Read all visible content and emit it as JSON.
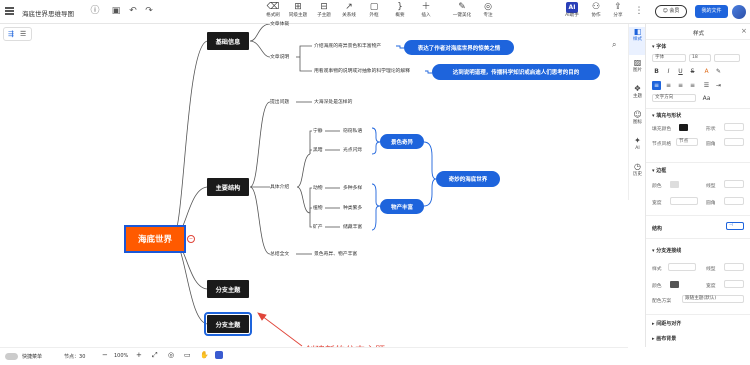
{
  "header": {
    "doc_title": "海底世界思维导图",
    "tools": [
      {
        "icon": "format-painter-icon",
        "label": "格式刷"
      },
      {
        "icon": "sibling-topic-icon",
        "label": "同级主题"
      },
      {
        "icon": "child-topic-icon",
        "label": "子主题"
      },
      {
        "icon": "relation-icon",
        "label": "关系线"
      },
      {
        "icon": "outline-box-icon",
        "label": "外框"
      },
      {
        "icon": "summary-icon",
        "label": "概要"
      },
      {
        "icon": "insert-icon",
        "label": "插入"
      },
      {
        "icon": "one-click-beautify-icon",
        "label": "一键美化"
      },
      {
        "icon": "focus-icon",
        "label": "专注"
      },
      {
        "icon": "ai-assistant-icon",
        "label": "AI助手",
        "badge": "AI"
      },
      {
        "icon": "collaborate-icon",
        "label": "协作"
      },
      {
        "icon": "share-icon",
        "label": "分享"
      }
    ],
    "upgrade_label": "会员",
    "my_files_label": "我的文件"
  },
  "mindmap": {
    "root": "海底世界",
    "branches": [
      {
        "label": "基础信息",
        "items": [
          {
            "label": "文章体裁"
          },
          {
            "label": "文章说明",
            "notes": [
              "介绍海底的奇异景色和丰富物产",
              "用看观事物的说明或对抽象的科学理论的解释"
            ],
            "callouts": [
              "表达了作者对海底世界的惊美之情",
              "达到说明道理，传播科学知识或启迪人们思考的目的"
            ]
          }
        ]
      },
      {
        "label": "主要结构",
        "items": [
          {
            "label": "提出问题",
            "answer": "大海深处是怎样的"
          },
          {
            "label": "具体介绍",
            "groups": [
              {
                "summary": "景色奇异",
                "rows": [
                  [
                    "宁静",
                    "窃窃私语"
                  ],
                  [
                    "黑暗",
                    "光点闪烁"
                  ]
                ]
              },
              {
                "summary": "物产丰富",
                "rows": [
                  [
                    "动物",
                    "多种多样"
                  ],
                  [
                    "植物",
                    "种类繁多"
                  ],
                  [
                    "矿产",
                    "储藏丰富"
                  ]
                ]
              }
            ],
            "conclusion": "奇妙的海底世界"
          },
          {
            "label": "总结全文",
            "answer": "景色奇异、物产丰富"
          }
        ]
      },
      {
        "label": "分支主题"
      },
      {
        "label": "分支主题"
      }
    ],
    "annotation": "创建新的分支主题"
  },
  "side_tabs": [
    {
      "icon": "style-icon",
      "label": "样式"
    },
    {
      "icon": "image-icon",
      "label": "图片"
    },
    {
      "icon": "theme-icon",
      "label": "主题"
    },
    {
      "icon": "icon-library-icon",
      "label": "图标"
    },
    {
      "icon": "ai-icon",
      "label": "AI"
    },
    {
      "icon": "history-icon",
      "label": "历史"
    }
  ],
  "panel": {
    "title": "样式",
    "sections": {
      "font": "字体",
      "fill_border": "填充与形状",
      "border": "边框",
      "structure": "结构",
      "branch_line": "分支连接线",
      "spacing": "间距与对齐",
      "canvas": "画布背景"
    },
    "font": {
      "family": "字体",
      "size": "18",
      "text_dir_label": "文字方向"
    },
    "fill": {
      "fill_label": "填充颜色",
      "shape_label": "形状",
      "node_style_label": "节点风格",
      "node_style_value": "节点",
      "corner_label": "圆角"
    },
    "border": {
      "color_label": "颜色",
      "line_label": "线型",
      "width_label": "宽度",
      "rounding_label": "圆角"
    },
    "branch": {
      "style_label": "样式",
      "line_label": "线型",
      "color_label": "颜色",
      "width_label": "宽度",
      "scheme_label": "配色方案",
      "scheme_value": "跟随主题(默认)"
    }
  },
  "status": {
    "quick_label": "快捷菜单",
    "nodes_label": "节点：",
    "nodes_count": "30",
    "zoom": "100%"
  },
  "colors": {
    "accent": "#1e64dc",
    "root": "#ff5a00",
    "dark_node": "#1a1a1a",
    "annotation": "#e0453a"
  }
}
